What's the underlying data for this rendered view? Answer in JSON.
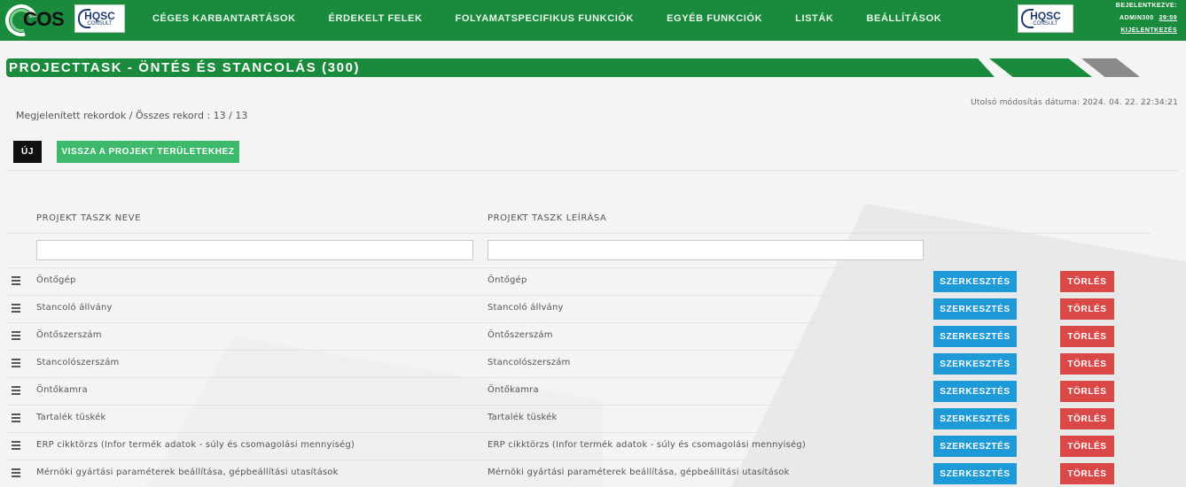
{
  "nav": {
    "logo_text": "COS",
    "hqsc_big": "HQSC",
    "hqsc_small": "CONSULT",
    "items": [
      {
        "label": "CÉGES KARBANTARTÁSOK"
      },
      {
        "label": "ÉRDEKELT FELEK"
      },
      {
        "label": "FOLYAMATSPECIFIKUS FUNKCIÓK"
      },
      {
        "label": "EGYÉB FUNKCIÓK"
      },
      {
        "label": "LISTÁK"
      },
      {
        "label": "BEÁLLÍTÁSOK"
      }
    ],
    "logged_in_label": "BEJELENTKEZVE:",
    "username": "ADMIN300",
    "session_timer": "29:59",
    "logout_label": "KIJELENTKEZÉS"
  },
  "page": {
    "title": "PROJECTTASK - ÖNTÉS ÉS STANCOLÁS (300)",
    "last_modified": "Utolsó módosítás dátuma: 2024. 04. 22. 22:34:21",
    "records_info": "Megjelenített rekordok / Összes rekord : 13 / 13",
    "new_button": "ÚJ",
    "back_button": "VISSZA A PROJEKT TERÜLETEKHEZ"
  },
  "table": {
    "col_name": "PROJEKT TASZK NEVE",
    "col_desc": "PROJEKT TASZK LEÍRÁSA",
    "filter_name_value": "",
    "filter_desc_value": "",
    "edit_label": "SZERKESZTÉS",
    "delete_label": "TÖRLÉS",
    "rows": [
      {
        "name": "Öntőgép",
        "desc": "Öntőgép"
      },
      {
        "name": "Stancoló állvány",
        "desc": "Stancoló állvány"
      },
      {
        "name": "Öntőszerszám",
        "desc": "Öntőszerszám"
      },
      {
        "name": "Stancolószerszám",
        "desc": "Stancolószerszám"
      },
      {
        "name": "Öntőkamra",
        "desc": "Öntőkamra"
      },
      {
        "name": "Tartalék tüskék",
        "desc": "Tartalék tüskék"
      },
      {
        "name": "ERP cikktörzs (Infor termék adatok - súly és csomagolási mennyiség)",
        "desc": "ERP cikktörzs (Infor termék adatok - súly és csomagolási mennyiség)"
      },
      {
        "name": "Mérnöki gyártási paraméterek beállítása, gépbeállítási utasítások",
        "desc": "Mérnöki gyártási paraméterek beállítása, gépbeállítási utasítások"
      }
    ]
  },
  "colors": {
    "brand_green": "#1a8a3c",
    "button_green": "#3cb96a",
    "edit_blue": "#1f9ad8",
    "delete_red": "#db4848"
  }
}
